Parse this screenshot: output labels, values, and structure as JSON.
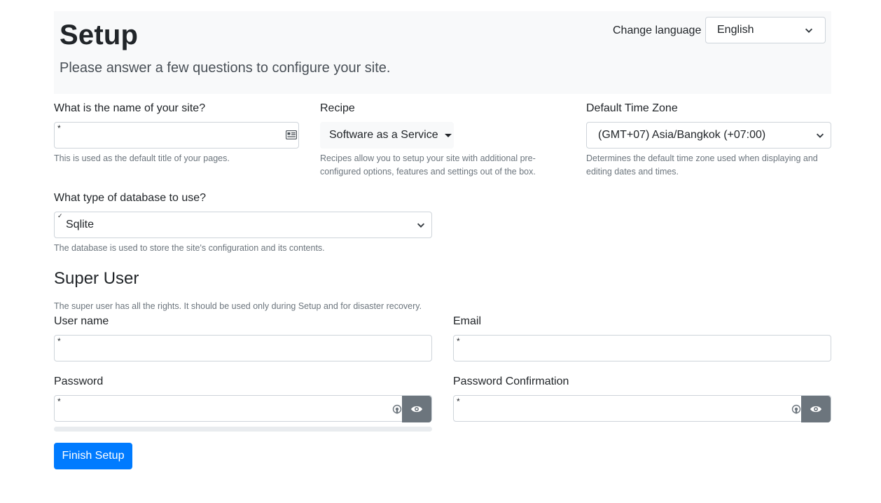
{
  "header": {
    "title": "Setup",
    "lead": "Please answer a few questions to configure your site.",
    "language_label": "Change language",
    "language_value": "English"
  },
  "site_name": {
    "label": "What is the name of your site?",
    "required_marker": "*",
    "value": "",
    "help": "This is used as the default title of your pages."
  },
  "recipe": {
    "label": "Recipe",
    "selected": "Software as a Service",
    "help_line1": "Recipes allow you to setup your site with additional pre-",
    "help_line2": "configured options, features and settings out of the box."
  },
  "timezone": {
    "label": "Default Time Zone",
    "selected": "(GMT+07) Asia/Bangkok (+07:00)",
    "help_line1": "Determines the default time zone used when displaying and",
    "help_line2": "editing dates and times."
  },
  "database": {
    "label": "What type of database to use?",
    "selected": "Sqlite",
    "valid_marker": "✓",
    "help": "The database is used to store the site's configuration and its contents."
  },
  "super_user": {
    "heading": "Super User",
    "help": "The super user has all the rights. It should be used only during Setup and for disaster recovery.",
    "username_label": "User name",
    "email_label": "Email",
    "password_label": "Password",
    "password_confirm_label": "Password Confirmation",
    "required_marker": "*",
    "password_strength": 0
  },
  "actions": {
    "finish_label": "Finish Setup"
  },
  "colors": {
    "primary": "#007bff",
    "secondary": "#6c757d",
    "jumbotron": "#f8f9fa"
  },
  "icons": [
    "id-card-icon",
    "chevron-down-icon",
    "caret-down-icon",
    "eye-icon",
    "generate-password-icon"
  ]
}
